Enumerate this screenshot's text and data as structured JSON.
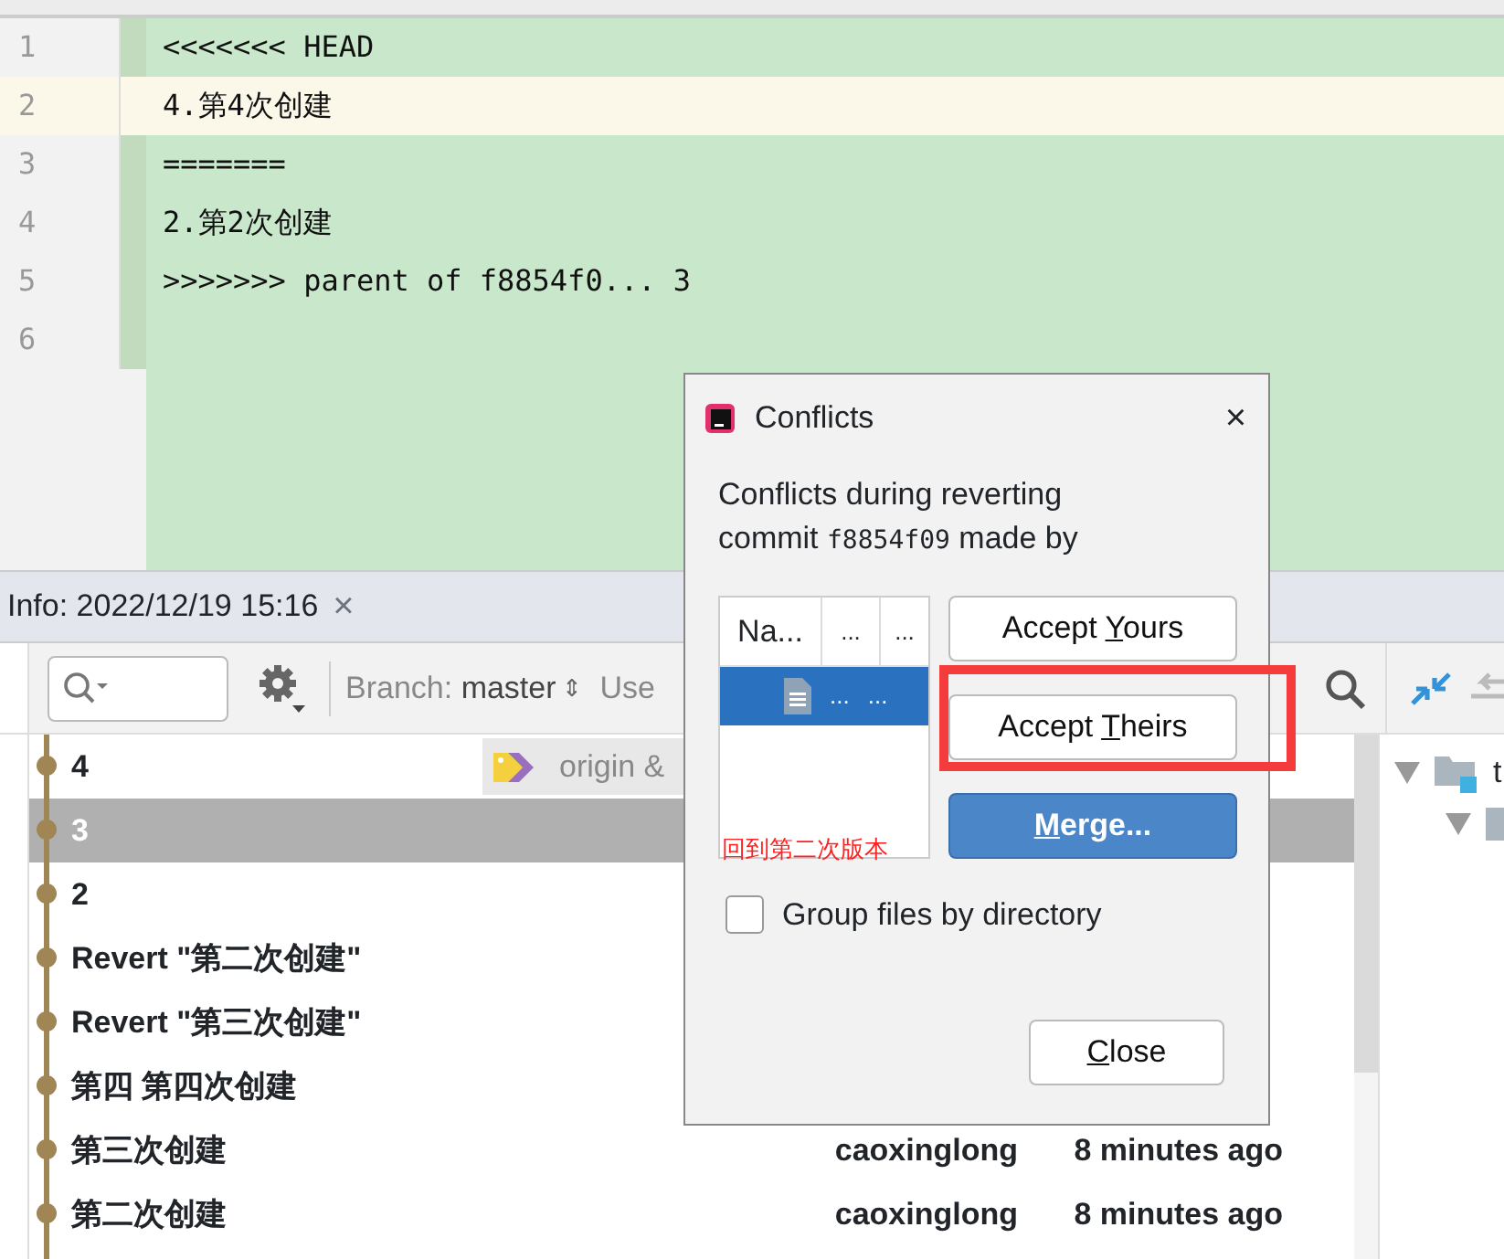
{
  "editor": {
    "lines": [
      {
        "number": "1",
        "text": "<<<<<<< HEAD",
        "current": false
      },
      {
        "number": "2",
        "text": "4.第4次创建",
        "current": true
      },
      {
        "number": "3",
        "text": "=======",
        "current": false
      },
      {
        "number": "4",
        "text": "2.第2次创建",
        "current": false
      },
      {
        "number": "5",
        "text": ">>>>>>> parent of f8854f0... 3",
        "current": false
      },
      {
        "number": "6",
        "current": false
      }
    ]
  },
  "tool_window": {
    "tab": "Info: 2022/12/19 15:16",
    "close": "×"
  },
  "toolbar": {
    "branch_label": "Branch:",
    "branch": "master",
    "branch_arrows": "⇕",
    "user_filter": "Use"
  },
  "log": {
    "rows": [
      {
        "subject": "4",
        "ref": "origin &",
        "selected": false
      },
      {
        "subject": "3",
        "selected": true
      },
      {
        "subject": "2",
        "selected": false
      },
      {
        "subject": "Revert \"第二次创建\"",
        "selected": false
      },
      {
        "subject": "Revert \"第三次创建\"",
        "selected": false
      },
      {
        "subject": "第四 第四次创建",
        "selected": false
      },
      {
        "subject": "第三次创建",
        "author": "caoxinglong",
        "time": "8 minutes ago",
        "selected": false
      },
      {
        "subject": "第二次创建",
        "author": "caoxinglong",
        "time": "8 minutes ago",
        "selected": false
      }
    ]
  },
  "changes_tree": {
    "root_label": "t"
  },
  "dialog": {
    "title": "Conflicts",
    "close": "×",
    "message": {
      "line1": "Conflicts during reverting",
      "prefix": "commit",
      "hash": "f8854f09",
      "suffix": "made by"
    },
    "table": {
      "columns": [
        "Na...",
        "...",
        "..."
      ],
      "rows": [
        {
          "cells": [
            "...",
            "..."
          ],
          "selected": true
        }
      ]
    },
    "annotation": "回到第二次版本",
    "buttons": [
      {
        "before": "Accept ",
        "mnemonic": "Y",
        "after": "ours",
        "kind": "default",
        "highlighted": false
      },
      {
        "before": "Accept ",
        "mnemonic": "T",
        "after": "heirs",
        "kind": "default",
        "highlighted": true
      },
      {
        "mnemonic": "M",
        "after": "erge...",
        "kind": "primary",
        "highlighted": false
      }
    ],
    "checkbox": {
      "label": "Group files by directory",
      "checked": false
    },
    "close_button": {
      "mnemonic": "C",
      "after": "lose"
    }
  }
}
